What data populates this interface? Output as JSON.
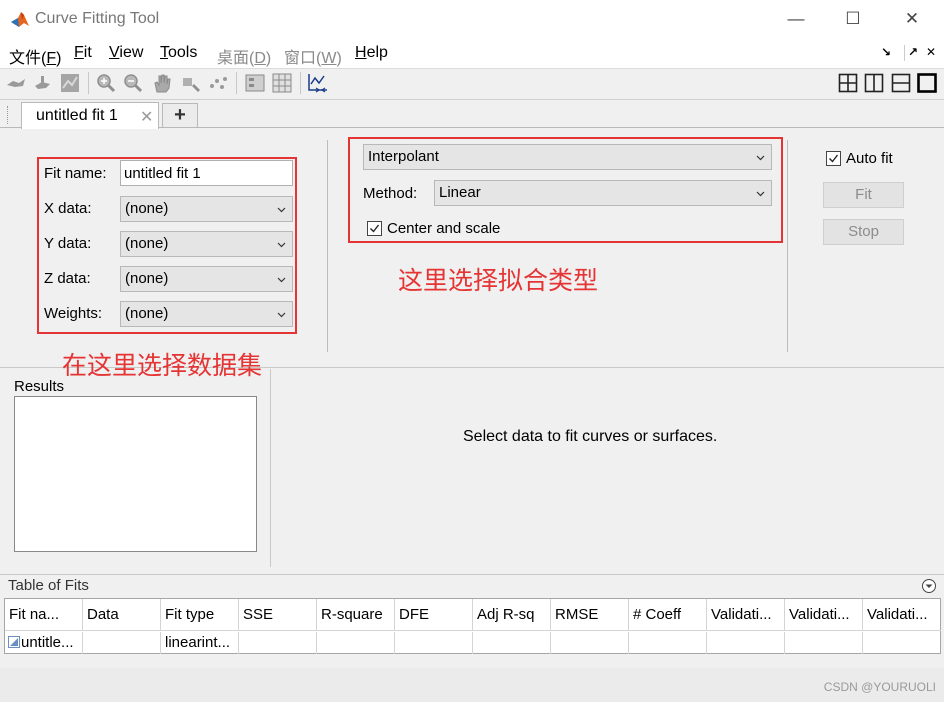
{
  "window": {
    "title": "Curve Fitting Tool",
    "minimize": "—",
    "maximize": "☐",
    "close": "✕"
  },
  "menu": {
    "items": [
      {
        "pre": "文件(",
        "key": "F",
        "post": ")"
      },
      {
        "pre": "",
        "key": "F",
        "post": "it"
      },
      {
        "pre": "",
        "key": "V",
        "post": "iew"
      },
      {
        "pre": "",
        "key": "T",
        "post": "ools"
      },
      {
        "pre": "桌面(",
        "key": "D",
        "post": ")"
      },
      {
        "pre": "窗口(",
        "key": "W",
        "post": ")"
      },
      {
        "pre": "",
        "key": "H",
        "post": "elp"
      }
    ],
    "right_icons": [
      "↘",
      "↗",
      "✕"
    ]
  },
  "tabs": {
    "active_label": "untitled fit 1",
    "close_glyph": "✕",
    "add_glyph": "+"
  },
  "data_panel": {
    "fit_name_label": "Fit name:",
    "fit_name_value": "untitled fit 1",
    "x_label": "X data:",
    "x_value": "(none)",
    "y_label": "Y data:",
    "y_value": "(none)",
    "z_label": "Z data:",
    "z_value": "(none)",
    "weights_label": "Weights:",
    "weights_value": "(none)"
  },
  "fit_panel": {
    "fit_type": "Interpolant",
    "method_label": "Method:",
    "method_value": "Linear",
    "center_scale_label": "Center and scale",
    "center_scale_checked": true
  },
  "control_panel": {
    "auto_fit_label": "Auto fit",
    "auto_fit_checked": true,
    "fit_button": "Fit",
    "stop_button": "Stop"
  },
  "annotations": {
    "fit_type_note": "这里选择拟合类型",
    "dataset_note": "在这里选择数据集"
  },
  "results": {
    "title": "Results",
    "plot_message": "Select data to fit curves or surfaces."
  },
  "table": {
    "title": "Table of Fits",
    "columns": [
      "Fit na...",
      "Data",
      "Fit type",
      "SSE",
      "R-square",
      "DFE",
      "Adj R-sq",
      "RMSE",
      "# Coeff",
      "Validati...",
      "Validati...",
      "Validati..."
    ],
    "rows": [
      [
        "untitle...",
        "",
        "linearint...",
        "",
        "",
        "",
        "",
        "",
        "",
        "",
        "",
        ""
      ]
    ]
  },
  "watermark": "CSDN @YOURUOLI",
  "colors": {
    "annotation_red": "#e53434",
    "matlab_orange": "#e8661f",
    "matlab_blue": "#2a73b8"
  }
}
